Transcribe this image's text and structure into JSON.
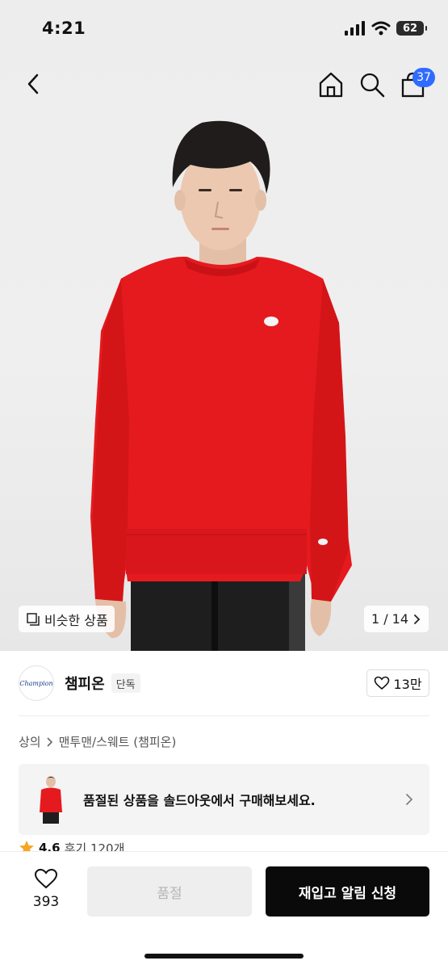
{
  "status_bar": {
    "time": "4:21",
    "battery": "62"
  },
  "header": {
    "cart_count": "37"
  },
  "gallery": {
    "similar_label": "비슷한 상품",
    "pager": "1 / 14"
  },
  "brand": {
    "name": "챔피온",
    "tag": "단독",
    "logo_text": "Champion",
    "likes": "13만"
  },
  "breadcrumb": [
    "상의",
    "맨투맨/스웨트 (챔피온)"
  ],
  "soldout_banner": {
    "text": "품절된 상품을 솔드아웃에서 구매해보세요."
  },
  "rating": {
    "score": "4.6",
    "reviews": "후기 120개"
  },
  "bottom_bar": {
    "wish_count": "393",
    "soldout_label": "품절",
    "restock_label": "재입고 알림 신청"
  },
  "colors": {
    "accent_badge": "#2f6bff",
    "primary_button": "#0a0a0a",
    "sweatshirt": "#e51a1f",
    "star": "#f5a623"
  }
}
